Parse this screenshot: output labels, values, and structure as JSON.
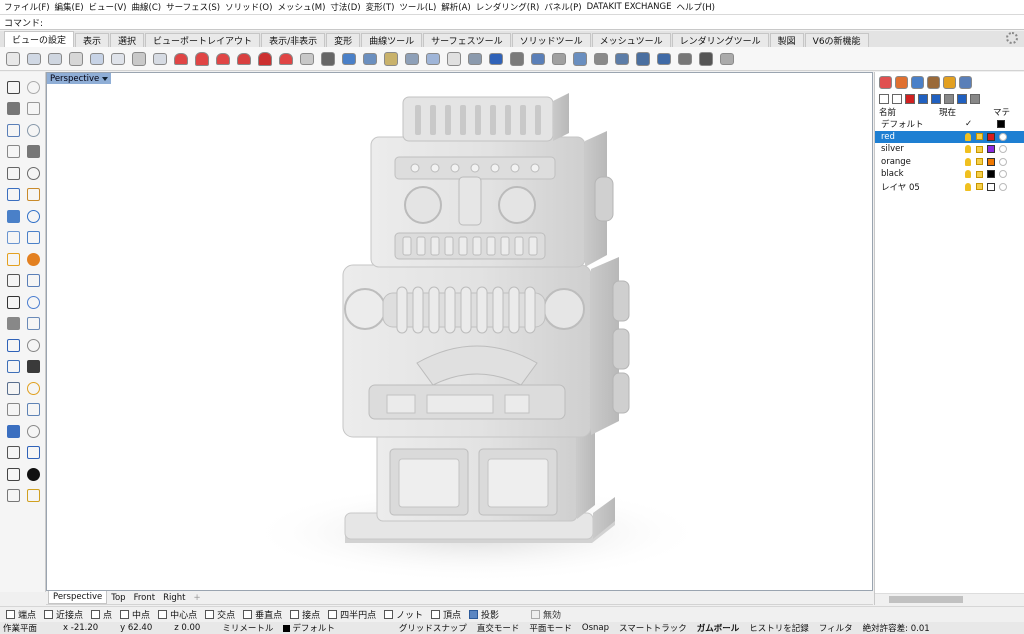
{
  "menu": [
    "ファイル(F)",
    "編集(E)",
    "ビュー(V)",
    "曲線(C)",
    "サーフェス(S)",
    "ソリッド(O)",
    "メッシュ(M)",
    "寸法(D)",
    "変形(T)",
    "ツール(L)",
    "解析(A)",
    "レンダリング(R)",
    "パネル(P)",
    "DATAKIT EXCHANGE",
    "ヘルプ(H)"
  ],
  "command": {
    "label": "コマンド:",
    "value": ""
  },
  "tabs": [
    "ビューの設定",
    "表示",
    "選択",
    "ビューポートレイアウト",
    "表示/非表示",
    "変形",
    "曲線ツール",
    "サーフェスツール",
    "ソリッドツール",
    "メッシュツール",
    "レンダリングツール",
    "製図",
    "V6の新機能"
  ],
  "viewport": {
    "label": "Perspective"
  },
  "viewport_tabs": [
    "Perspective",
    "Top",
    "Front",
    "Right"
  ],
  "layers": {
    "col_name": "名前",
    "col_current": "現在",
    "col_material": "マテ",
    "default": {
      "name": "デフォルト",
      "check": "✓"
    },
    "rows": [
      {
        "name": "red",
        "color": "#d81b1b"
      },
      {
        "name": "silver",
        "color": "#8a2be2"
      },
      {
        "name": "orange",
        "color": "#f07800"
      },
      {
        "name": "black",
        "color": "#000000"
      },
      {
        "name": "レイヤ 05",
        "color": "#ffffff"
      }
    ]
  },
  "osnap": [
    {
      "label": "端点",
      "state": "off"
    },
    {
      "label": "近接点",
      "state": "off"
    },
    {
      "label": "点",
      "state": "off"
    },
    {
      "label": "中点",
      "state": "off"
    },
    {
      "label": "中心点",
      "state": "off"
    },
    {
      "label": "交点",
      "state": "off"
    },
    {
      "label": "垂直点",
      "state": "off"
    },
    {
      "label": "接点",
      "state": "off"
    },
    {
      "label": "四半円点",
      "state": "off"
    },
    {
      "label": "ノット",
      "state": "off"
    },
    {
      "label": "頂点",
      "state": "off"
    },
    {
      "label": "投影",
      "state": "on"
    },
    {
      "label": "無効",
      "state": "disabled"
    }
  ],
  "status": {
    "cplane": "作業平面",
    "x": "x -21.20",
    "y": "y 62.40",
    "z": "z 0.00",
    "unit": "ミリメートル",
    "layer": "デフォルト",
    "grid_snap": "グリッドスナップ",
    "ortho": "直交モード",
    "planar": "平面モード",
    "osnap": "Osnap",
    "smarttrack": "スマートトラック",
    "gumball": "ガムボール",
    "history": "ヒストリを記録",
    "filter": "フィルタ",
    "tolerance": "絶対許容差: 0.01"
  }
}
